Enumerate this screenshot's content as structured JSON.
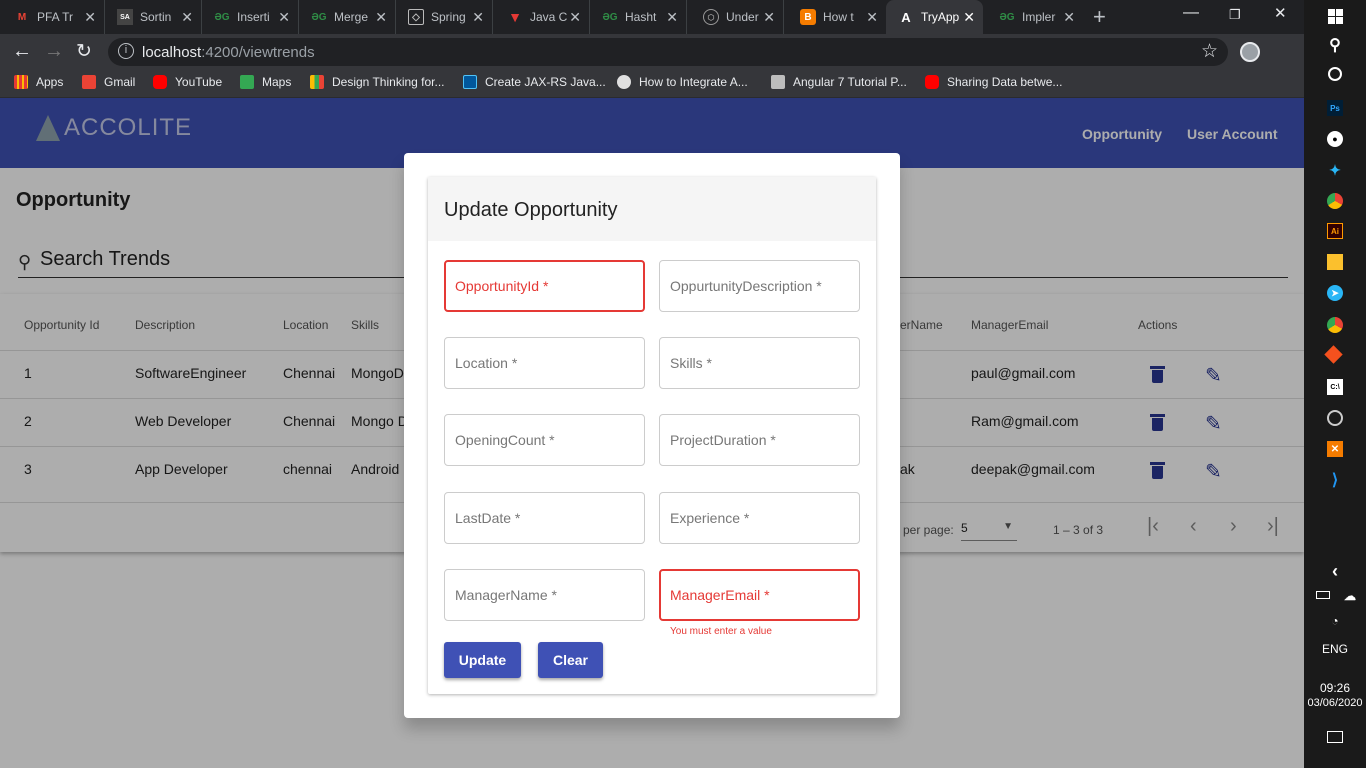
{
  "browser": {
    "tabs": [
      {
        "title": "PFA Tr",
        "icon": "gmail-icon",
        "color": "#ea4335"
      },
      {
        "title": "Sortin",
        "icon": "sa-icon",
        "color": "#444"
      },
      {
        "title": "Inserti",
        "icon": "gfg-icon",
        "color": "#2f8d46"
      },
      {
        "title": "Merge",
        "icon": "gfg-icon",
        "color": "#2f8d46"
      },
      {
        "title": "Spring",
        "icon": "spring-icon",
        "color": "#888"
      },
      {
        "title": "Java C",
        "icon": "v-icon",
        "color": "#e53935"
      },
      {
        "title": "Hasht",
        "icon": "gfg-icon",
        "color": "#2f8d46"
      },
      {
        "title": "Under",
        "icon": "globe-icon",
        "color": "#777"
      },
      {
        "title": "How t",
        "icon": "blogger-icon",
        "color": "#f57c00"
      },
      {
        "title": "TryApp",
        "icon": "angular-icon",
        "color": "#fff"
      },
      {
        "title": "Impler",
        "icon": "gfg-icon",
        "color": "#2f8d46"
      }
    ],
    "url_host": "localhost",
    "url_path": ":4200/viewtrends",
    "bookmarks": [
      {
        "label": "Apps",
        "color": "#e53935"
      },
      {
        "label": "Gmail",
        "color": "#ea4335"
      },
      {
        "label": "YouTube",
        "color": "#ff0000"
      },
      {
        "label": "Maps",
        "color": "#34a853"
      },
      {
        "label": "Design Thinking for...",
        "color": "#fbbc04"
      },
      {
        "label": "Create JAX-RS Java...",
        "color": "#0277bd"
      },
      {
        "label": "How to Integrate A...",
        "color": "#e0e0e0"
      },
      {
        "label": "Angular 7 Tutorial P...",
        "color": "#bdbdbd"
      },
      {
        "label": "Sharing Data betwe...",
        "color": "#ff0000"
      }
    ]
  },
  "app": {
    "logo_text": "ACCOLITE",
    "nav": [
      "Opportunity",
      "User Account"
    ],
    "page_title": "Opportunity",
    "search_label": "Search Trends"
  },
  "table": {
    "headers": [
      "Opportunity Id",
      "Description",
      "Location",
      "Skills",
      "erName",
      "ManagerEmail",
      "Actions"
    ],
    "rows": [
      {
        "id": "1",
        "description": "SoftwareEngineer",
        "location": "Chennai",
        "skills": "MongoD",
        "manager": "",
        "email": "paul@gmail.com"
      },
      {
        "id": "2",
        "description": "Web Developer",
        "location": "Chennai",
        "skills": "Mongo D",
        "manager": "",
        "email": "Ram@gmail.com"
      },
      {
        "id": "3",
        "description": "App Developer",
        "location": "chennai",
        "skills": "Android",
        "manager": "ak",
        "email": "deepak@gmail.com"
      }
    ],
    "paginator": {
      "per_page_label": "per page:",
      "per_page_value": "5",
      "range": "1 – 3 of 3"
    }
  },
  "dialog": {
    "title": "Update Opportunity",
    "fields": [
      {
        "label": "OpportunityId *",
        "error": true
      },
      {
        "label": "OppurtunityDescription *",
        "error": false
      },
      {
        "label": "Location *",
        "error": false
      },
      {
        "label": "Skills *",
        "error": false
      },
      {
        "label": "OpeningCount *",
        "error": false
      },
      {
        "label": "ProjectDuration *",
        "error": false
      },
      {
        "label": "LastDate *",
        "error": false
      },
      {
        "label": "Experience *",
        "error": false
      },
      {
        "label": "ManagerName *",
        "error": false
      },
      {
        "label": "ManagerEmail *",
        "error": true
      }
    ],
    "error_message": "You must enter a value",
    "update_label": "Update",
    "clear_label": "Clear"
  },
  "taskbar": {
    "language": "ENG",
    "time": "09:26",
    "date": "03/06/2020"
  },
  "colors": {
    "primary": "#3f51b5",
    "error": "#e53935"
  }
}
